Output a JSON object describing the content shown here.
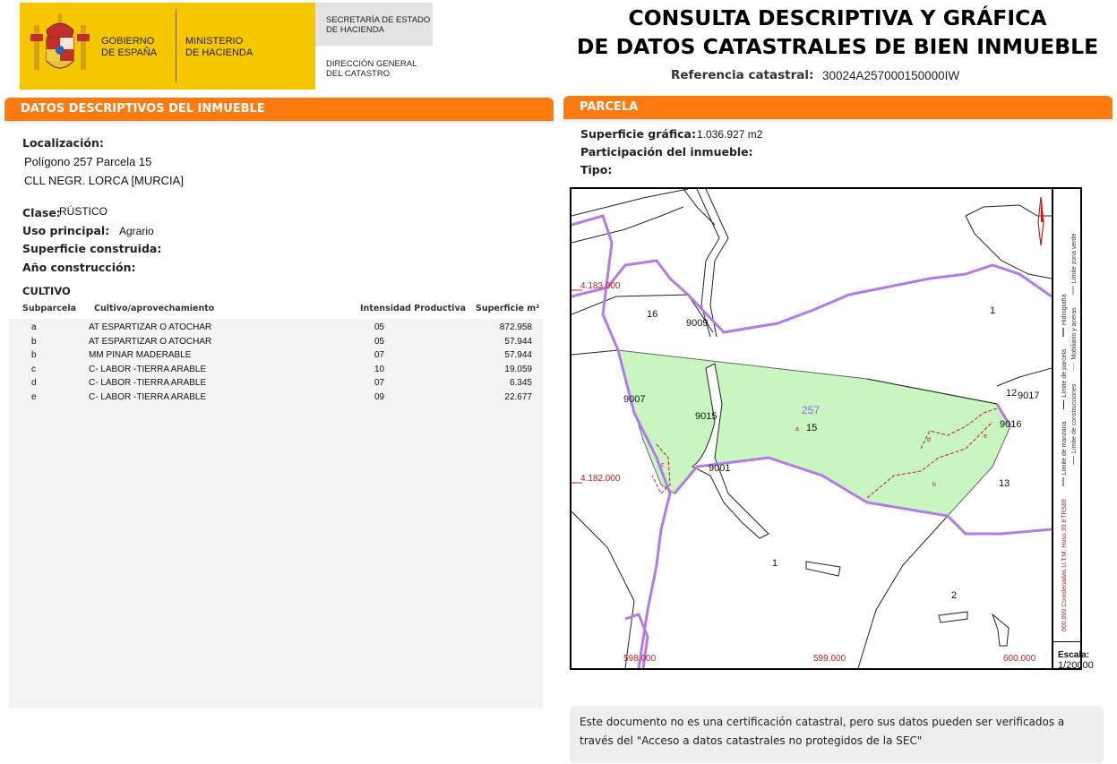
{
  "header": {
    "gov_line1": "GOBIERNO",
    "gov_line2": "DE ESPAÑA",
    "ministry_line1": "MINISTERIO",
    "ministry_line2": "DE HACIENDA",
    "secretaria": "SECRETARÍA DE ESTADO\nDE HACIENDA",
    "direccion": "DIRECCIÓN GENERAL\nDEL CATASTRO",
    "title_line1": "CONSULTA DESCRIPTIVA Y GRÁFICA",
    "title_line2": "DE DATOS CATASTRALES DE BIEN INMUEBLE",
    "ref_label": "Referencia catastral:",
    "ref_value": "30024A257000150000IW",
    "brand_yellow": "#f6c700",
    "accent_orange": "#ff7a10"
  },
  "left": {
    "section_title": "DATOS DESCRIPTIVOS DEL INMUEBLE",
    "localizacion_label": "Localización:",
    "localizacion_line1": "Polígono 257 Parcela 15",
    "localizacion_line2": "CLL NEGR. LORCA [MURCIA]",
    "clase_label": "Clase:",
    "clase_value": "RÚSTICO",
    "uso_label": "Uso principal:",
    "uso_value": "Agrario",
    "superficie_label": "Superficie construida:",
    "anio_label": "Año construcción:"
  },
  "cultivo": {
    "title": "CULTIVO",
    "headers": [
      "Subparcela",
      "Cultivo/aprovechamiento",
      "Intensidad Productiva",
      "Superficie m²"
    ],
    "rows": [
      [
        "a",
        "AT ESPARTIZAR O ATOCHAR",
        "05",
        "872.958"
      ],
      [
        "b",
        "AT ESPARTIZAR O ATOCHAR",
        "05",
        "57.944"
      ],
      [
        "b",
        "MM PINAR MADERABLE",
        "07",
        "57.944"
      ],
      [
        "c",
        "C- LABOR -TIERRA ARABLE",
        "10",
        "19.059"
      ],
      [
        "d",
        "C- LABOR -TIERRA ARABLE",
        "07",
        "6.345"
      ],
      [
        "e",
        "C- LABOR -TIERRA ARABLE",
        "09",
        "22.677"
      ]
    ]
  },
  "parcela": {
    "section_title": "PARCELA",
    "superficie_label": "Superficie gráfica:",
    "superficie_value": "1.036.927 m2",
    "participacion_label": "Participación del inmueble:",
    "tipo_label": "Tipo:"
  },
  "map": {
    "y_coords": [
      "4.183.000",
      "4.182.000"
    ],
    "x_coords": [
      "598.000",
      "599.000",
      "600.000"
    ],
    "labels": [
      "16",
      "9009",
      "1",
      "9007",
      "9015",
      "257",
      "15",
      "12",
      "9017",
      "9016",
      "9001",
      "13",
      "1",
      "2",
      "a",
      "b",
      "c",
      "d",
      "e"
    ],
    "legend_items": [
      "Hidrografía",
      "Límite zona verde",
      "Límite de parcela",
      "Mobiliario y aceras",
      "Límite de manzana",
      "Límite de construcciones"
    ],
    "legend_coords": "600.000 Coordenadas U.T.M. Huso 30 ETRS89",
    "scale_label": "Escala:",
    "scale_value": "1/20000",
    "colors": {
      "parcel_fill": "#c9f5c0",
      "hydro": "#b27be8",
      "coords": "#c02020"
    }
  },
  "note": "Este documento no es una certificación catastral, pero sus datos pueden ser verificados a través del \"Acceso a datos catastrales no protegidos de la SEC\""
}
